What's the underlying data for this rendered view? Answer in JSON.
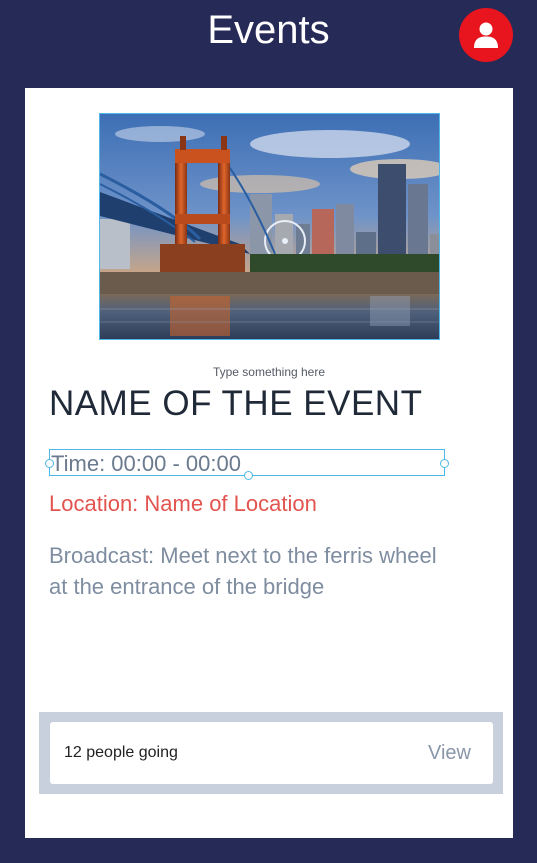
{
  "header": {
    "title": "Events",
    "profile_icon": "user-icon"
  },
  "event": {
    "image_alt": "city-skyline-bridge-photo",
    "hint": "Type something here",
    "name": "NAME OF THE EVENT",
    "time": "Time: 00:00 - 00:00",
    "location": "Location: Name of Location",
    "broadcast": "Broadcast: Meet next to the ferris wheel at the entrance of the bridge"
  },
  "footer": {
    "going": "12 people going",
    "view_label": "View"
  },
  "colors": {
    "background": "#252a57",
    "accent_red": "#e8151e",
    "location_red": "#e2544f",
    "selection_blue": "#4fb8e8"
  }
}
